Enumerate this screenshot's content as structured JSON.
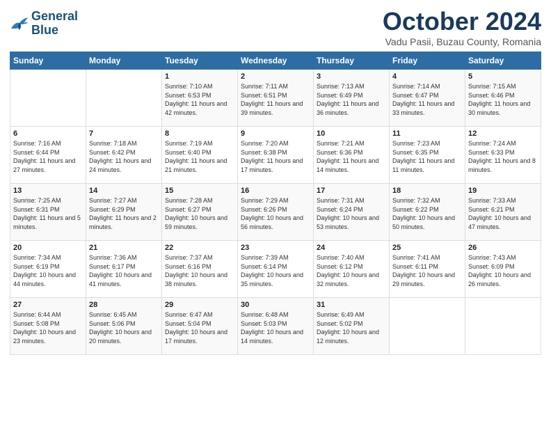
{
  "header": {
    "logo_line1": "General",
    "logo_line2": "Blue",
    "month_title": "October 2024",
    "subtitle": "Vadu Pasii, Buzau County, Romania"
  },
  "weekdays": [
    "Sunday",
    "Monday",
    "Tuesday",
    "Wednesday",
    "Thursday",
    "Friday",
    "Saturday"
  ],
  "weeks": [
    [
      {
        "day": "",
        "info": ""
      },
      {
        "day": "",
        "info": ""
      },
      {
        "day": "1",
        "info": "Sunrise: 7:10 AM\nSunset: 6:53 PM\nDaylight: 11 hours and 42 minutes."
      },
      {
        "day": "2",
        "info": "Sunrise: 7:11 AM\nSunset: 6:51 PM\nDaylight: 11 hours and 39 minutes."
      },
      {
        "day": "3",
        "info": "Sunrise: 7:13 AM\nSunset: 6:49 PM\nDaylight: 11 hours and 36 minutes."
      },
      {
        "day": "4",
        "info": "Sunrise: 7:14 AM\nSunset: 6:47 PM\nDaylight: 11 hours and 33 minutes."
      },
      {
        "day": "5",
        "info": "Sunrise: 7:15 AM\nSunset: 6:46 PM\nDaylight: 11 hours and 30 minutes."
      }
    ],
    [
      {
        "day": "6",
        "info": "Sunrise: 7:16 AM\nSunset: 6:44 PM\nDaylight: 11 hours and 27 minutes."
      },
      {
        "day": "7",
        "info": "Sunrise: 7:18 AM\nSunset: 6:42 PM\nDaylight: 11 hours and 24 minutes."
      },
      {
        "day": "8",
        "info": "Sunrise: 7:19 AM\nSunset: 6:40 PM\nDaylight: 11 hours and 21 minutes."
      },
      {
        "day": "9",
        "info": "Sunrise: 7:20 AM\nSunset: 6:38 PM\nDaylight: 11 hours and 17 minutes."
      },
      {
        "day": "10",
        "info": "Sunrise: 7:21 AM\nSunset: 6:36 PM\nDaylight: 11 hours and 14 minutes."
      },
      {
        "day": "11",
        "info": "Sunrise: 7:23 AM\nSunset: 6:35 PM\nDaylight: 11 hours and 11 minutes."
      },
      {
        "day": "12",
        "info": "Sunrise: 7:24 AM\nSunset: 6:33 PM\nDaylight: 11 hours and 8 minutes."
      }
    ],
    [
      {
        "day": "13",
        "info": "Sunrise: 7:25 AM\nSunset: 6:31 PM\nDaylight: 11 hours and 5 minutes."
      },
      {
        "day": "14",
        "info": "Sunrise: 7:27 AM\nSunset: 6:29 PM\nDaylight: 11 hours and 2 minutes."
      },
      {
        "day": "15",
        "info": "Sunrise: 7:28 AM\nSunset: 6:27 PM\nDaylight: 10 hours and 59 minutes."
      },
      {
        "day": "16",
        "info": "Sunrise: 7:29 AM\nSunset: 6:26 PM\nDaylight: 10 hours and 56 minutes."
      },
      {
        "day": "17",
        "info": "Sunrise: 7:31 AM\nSunset: 6:24 PM\nDaylight: 10 hours and 53 minutes."
      },
      {
        "day": "18",
        "info": "Sunrise: 7:32 AM\nSunset: 6:22 PM\nDaylight: 10 hours and 50 minutes."
      },
      {
        "day": "19",
        "info": "Sunrise: 7:33 AM\nSunset: 6:21 PM\nDaylight: 10 hours and 47 minutes."
      }
    ],
    [
      {
        "day": "20",
        "info": "Sunrise: 7:34 AM\nSunset: 6:19 PM\nDaylight: 10 hours and 44 minutes."
      },
      {
        "day": "21",
        "info": "Sunrise: 7:36 AM\nSunset: 6:17 PM\nDaylight: 10 hours and 41 minutes."
      },
      {
        "day": "22",
        "info": "Sunrise: 7:37 AM\nSunset: 6:16 PM\nDaylight: 10 hours and 38 minutes."
      },
      {
        "day": "23",
        "info": "Sunrise: 7:39 AM\nSunset: 6:14 PM\nDaylight: 10 hours and 35 minutes."
      },
      {
        "day": "24",
        "info": "Sunrise: 7:40 AM\nSunset: 6:12 PM\nDaylight: 10 hours and 32 minutes."
      },
      {
        "day": "25",
        "info": "Sunrise: 7:41 AM\nSunset: 6:11 PM\nDaylight: 10 hours and 29 minutes."
      },
      {
        "day": "26",
        "info": "Sunrise: 7:43 AM\nSunset: 6:09 PM\nDaylight: 10 hours and 26 minutes."
      }
    ],
    [
      {
        "day": "27",
        "info": "Sunrise: 6:44 AM\nSunset: 5:08 PM\nDaylight: 10 hours and 23 minutes."
      },
      {
        "day": "28",
        "info": "Sunrise: 6:45 AM\nSunset: 5:06 PM\nDaylight: 10 hours and 20 minutes."
      },
      {
        "day": "29",
        "info": "Sunrise: 6:47 AM\nSunset: 5:04 PM\nDaylight: 10 hours and 17 minutes."
      },
      {
        "day": "30",
        "info": "Sunrise: 6:48 AM\nSunset: 5:03 PM\nDaylight: 10 hours and 14 minutes."
      },
      {
        "day": "31",
        "info": "Sunrise: 6:49 AM\nSunset: 5:02 PM\nDaylight: 10 hours and 12 minutes."
      },
      {
        "day": "",
        "info": ""
      },
      {
        "day": "",
        "info": ""
      }
    ]
  ]
}
